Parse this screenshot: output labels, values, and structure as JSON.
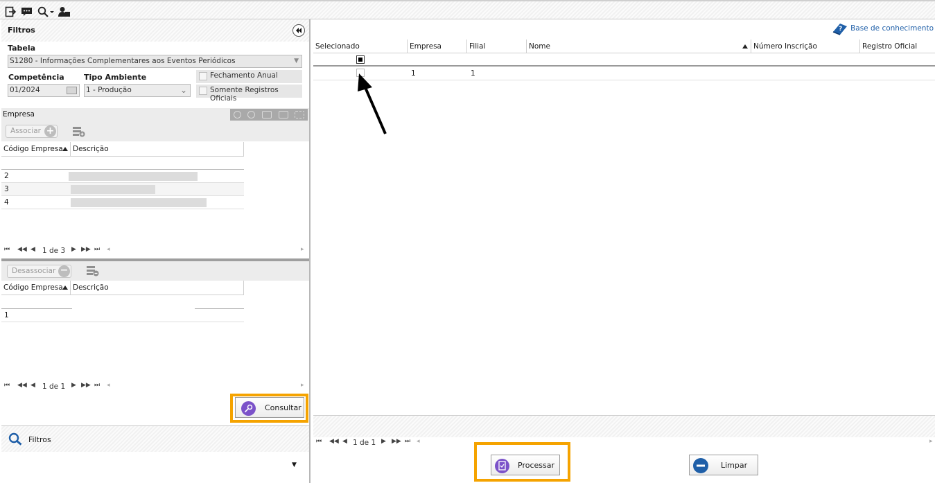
{
  "toolbar": {
    "icons": [
      "exit-icon",
      "chat-icon",
      "search-dropdown-icon",
      "user-icon"
    ]
  },
  "filters": {
    "title": "Filtros",
    "tabela_label": "Tabela",
    "tabela_value": "S1280 - Informações Complementares aos Eventos Periódicos",
    "competencia_label": "Competência",
    "competencia_value": "01/2024",
    "tipo_ambiente_label": "Tipo Ambiente",
    "tipo_ambiente_value": "1 - Produção",
    "fechamento_anual_label": "Fechamento Anual",
    "somente_registros_label": "Somente Registros Oficiais"
  },
  "empresa": {
    "section_label": "Empresa",
    "associar_label": "Associar",
    "desassociar_label": "Desassociar",
    "col_codigo": "Código Empresa",
    "col_descricao": "Descrição",
    "available_rows": [
      {
        "code": "2"
      },
      {
        "code": "3"
      },
      {
        "code": "4"
      }
    ],
    "available_pager": "1 de 3",
    "associated_rows": [
      {
        "code": "1"
      }
    ],
    "associated_pager": "1 de 1"
  },
  "actions": {
    "consultar_label": "Consultar",
    "processar_label": "Processar",
    "limpar_label": "Limpar"
  },
  "bottom_nav": {
    "filtros_label": "Filtros"
  },
  "results": {
    "help_link": "Base de conhecimento",
    "columns": [
      "Selecionado",
      "Empresa",
      "Filial",
      "Nome",
      "Número Inscrição",
      "Registro Oficial"
    ],
    "rows": [
      {
        "selecionado": false,
        "empresa": "1",
        "filial": "1",
        "nome": "",
        "inscricao": "",
        "registro": ""
      }
    ],
    "pager": "1 de 1"
  },
  "colors": {
    "highlight": "#f5a300",
    "help_icon": "#1f5fa8",
    "action_icon": "#7b52c9"
  }
}
